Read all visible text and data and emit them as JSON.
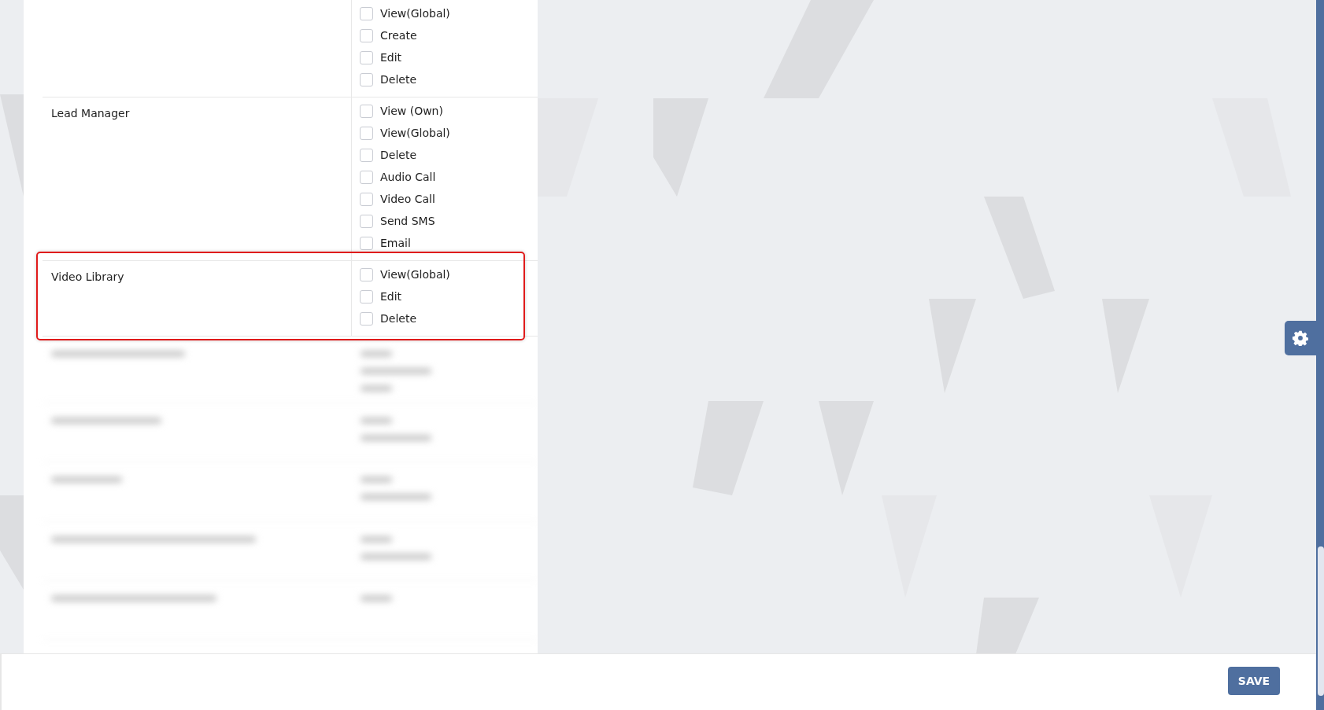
{
  "permissions": [
    {
      "options": [
        {
          "label": "View(Global)",
          "checked": false
        },
        {
          "label": "Create",
          "checked": false
        },
        {
          "label": "Edit",
          "checked": false
        },
        {
          "label": "Delete",
          "checked": false
        }
      ]
    },
    {
      "module": "Lead Manager",
      "options": [
        {
          "label": "View (Own)",
          "checked": false
        },
        {
          "label": "View(Global)",
          "checked": false
        },
        {
          "label": "Delete",
          "checked": false
        },
        {
          "label": "Audio Call",
          "checked": false
        },
        {
          "label": "Video Call",
          "checked": false
        },
        {
          "label": "Send SMS",
          "checked": false
        },
        {
          "label": "Email",
          "checked": false
        }
      ]
    },
    {
      "module": "Video Library",
      "highlighted": true,
      "options": [
        {
          "label": "View(Global)",
          "checked": false
        },
        {
          "label": "Edit",
          "checked": false
        },
        {
          "label": "Delete",
          "checked": false
        }
      ]
    }
  ],
  "footer": {
    "save_button": "SAVE"
  }
}
